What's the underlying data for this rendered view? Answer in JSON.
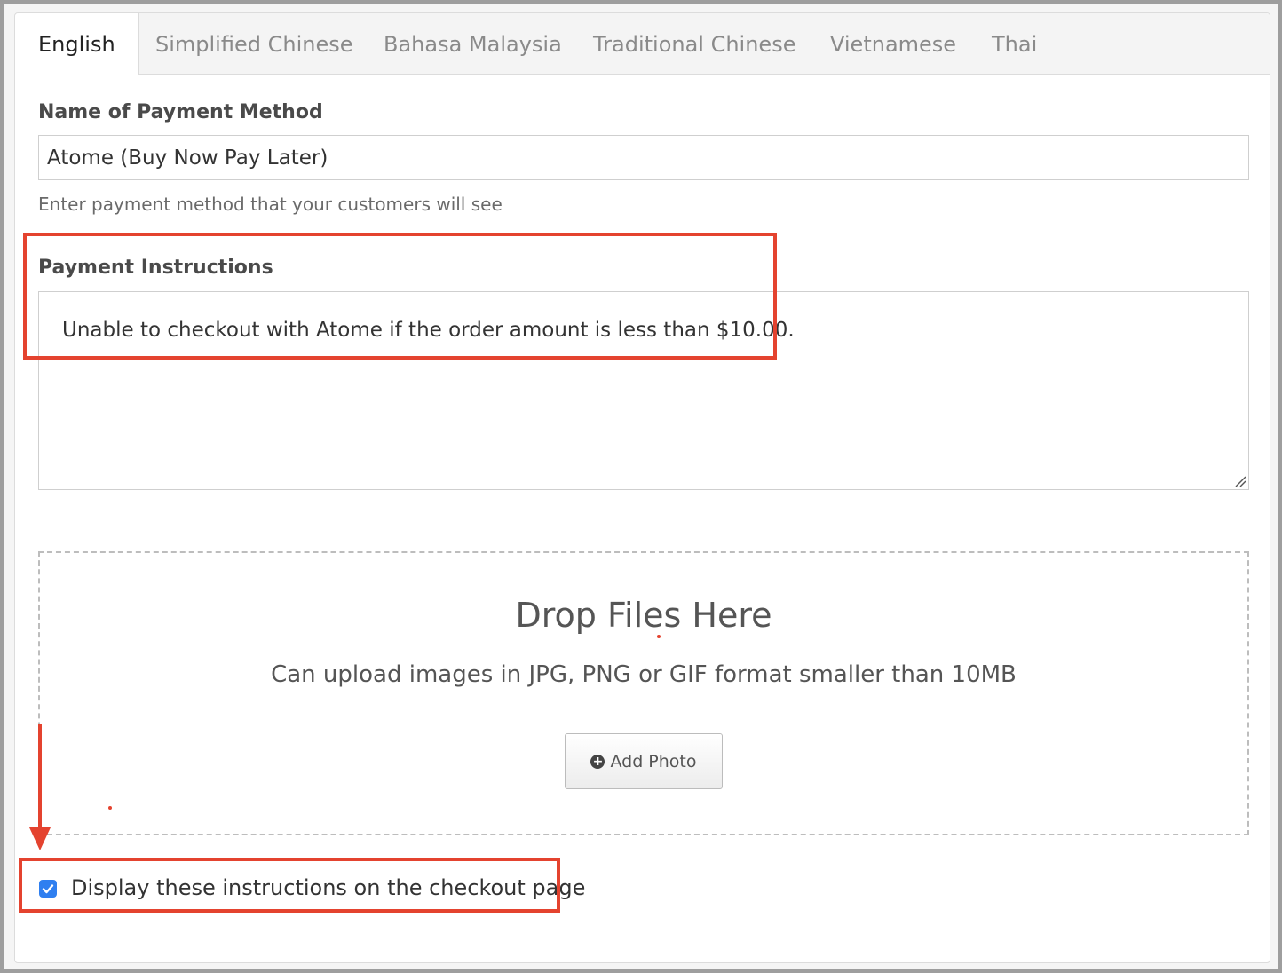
{
  "tabs": [
    {
      "label": "English",
      "active": true
    },
    {
      "label": "Simplified Chinese",
      "active": false
    },
    {
      "label": "Bahasa Malaysia",
      "active": false
    },
    {
      "label": "Traditional Chinese",
      "active": false
    },
    {
      "label": "Vietnamese",
      "active": false
    },
    {
      "label": "Thai",
      "active": false
    }
  ],
  "name_field": {
    "label": "Name of Payment Method",
    "value": "Atome (Buy Now Pay Later)",
    "help": "Enter payment method that your customers will see"
  },
  "instructions": {
    "label": "Payment Instructions",
    "value": "Unable to checkout with Atome if the order amount is less than $10.00."
  },
  "dropzone": {
    "title": "Drop Files Here",
    "subtitle": "Can upload images in JPG, PNG or GIF format smaller than 10MB",
    "button_label": "Add Photo",
    "button_icon": "plus-circle-icon"
  },
  "display_checkbox": {
    "label": "Display these instructions on the checkout page",
    "checked": true
  },
  "colors": {
    "annotation": "#e4432f",
    "checkbox": "#2f7ff0"
  }
}
